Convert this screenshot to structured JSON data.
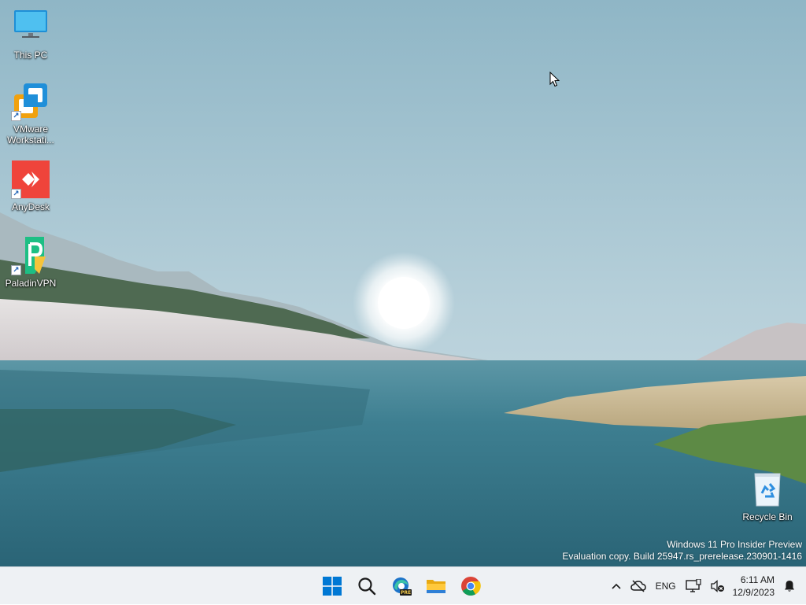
{
  "desktop": {
    "icons": [
      {
        "label": "This PC",
        "icon": "this-pc-icon"
      },
      {
        "label": "VMware Workstati...",
        "icon": "vmware-icon"
      },
      {
        "label": "AnyDesk",
        "icon": "anydesk-icon"
      },
      {
        "label": "PaladinVPN",
        "icon": "paladinvpn-icon"
      },
      {
        "label": "Recycle Bin",
        "icon": "recycle-bin-icon"
      }
    ],
    "watermark": {
      "line1": "Windows 11 Pro Insider Preview",
      "line2": "Evaluation copy. Build 25947.rs_prerelease.230901-1416"
    }
  },
  "taskbar": {
    "apps": [
      {
        "name": "Start",
        "icon": "windows-start-icon"
      },
      {
        "name": "Search",
        "icon": "search-icon"
      },
      {
        "name": "Microsoft Edge Preview",
        "icon": "edge-preview-icon",
        "badge": "PRE"
      },
      {
        "name": "File Explorer",
        "icon": "file-explorer-icon"
      },
      {
        "name": "Google Chrome",
        "icon": "chrome-icon"
      }
    ],
    "tray": {
      "language": "ENG",
      "time": "6:11 AM",
      "date": "12/9/2023"
    }
  },
  "colors": {
    "taskbar_bg": "#eef1f4",
    "windows_blue": "#0078d4",
    "anydesk_red": "#ef443b"
  }
}
